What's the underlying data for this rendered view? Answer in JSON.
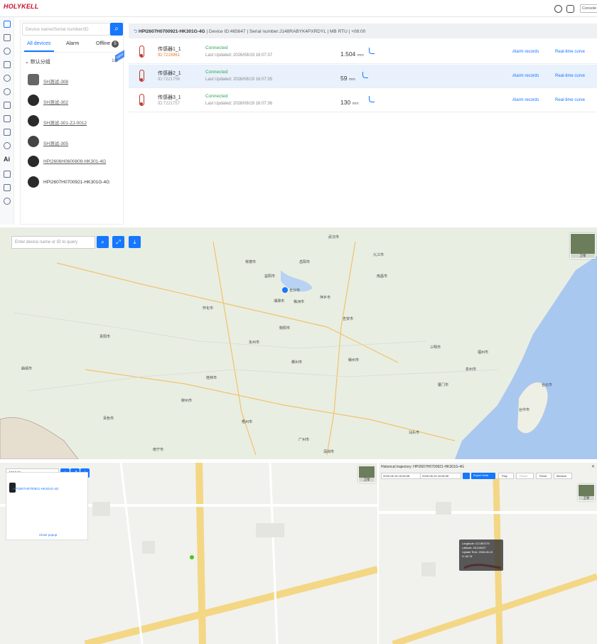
{
  "app": {
    "logo": "HOLYKELL",
    "logo_sub": "",
    "console_label": "Console"
  },
  "device_panel": {
    "search_placeholder": "Device name/Serial number/ID",
    "tabs": [
      {
        "label": "All devices"
      },
      {
        "label": "Alarm"
      },
      {
        "label": "Offline"
      }
    ],
    "offline_count": "5",
    "new_badge": "NEW",
    "group_label": "默认分组",
    "group_count": "1/6",
    "devices": [
      {
        "name": "SH测试-308"
      },
      {
        "name": "SH测试-302"
      },
      {
        "name": "SH测试-301-ZJ-0012"
      },
      {
        "name": "SH测试-305"
      },
      {
        "name": "HPI2606H0600809-HK301-4G"
      },
      {
        "name": "HPI2607H0700921-HK301G-4G"
      }
    ]
  },
  "sensor_header": {
    "device_name": "HPI2607H0700921-HK301G-4G",
    "device_id": "Device ID:465647",
    "serial": "Serial number:J148RABYK4PXRDYL",
    "protocol": "MB RTU",
    "timezone": "+08:00"
  },
  "sensors": [
    {
      "name": "传感器1_1",
      "id": "ID:7215961",
      "status": "Connected",
      "updated": "Last Updated: 2026/08/19 16:07:37",
      "value": "1.504",
      "unit": "mm",
      "alarm": "Alarm records",
      "realtime": "Real-time curve"
    },
    {
      "name": "传感器2_1",
      "id": "ID:7221756",
      "status": "Connected",
      "updated": "Last Updated: 2026/08/19 16:07:35",
      "value": "59",
      "unit": "mm",
      "alarm": "Alarm records",
      "realtime": "Real-time curve"
    },
    {
      "name": "传感器3_1",
      "id": "ID:7221757",
      "status": "Connected",
      "updated": "Last Updated: 2026/08/19 16:07:36",
      "value": "130",
      "unit": "mm",
      "alarm": "Alarm records",
      "realtime": "Real-time curve"
    }
  ],
  "map1": {
    "search_placeholder": "Enter device name or ID to query",
    "satellite_label": "卫星",
    "cities": [
      {
        "name": "长沙市"
      },
      {
        "name": "湘潭市"
      },
      {
        "name": "株洲市"
      },
      {
        "name": "益阳市"
      },
      {
        "name": "常德市"
      },
      {
        "name": "南昌市"
      },
      {
        "name": "九江市"
      },
      {
        "name": "贵阳市"
      },
      {
        "name": "福州市"
      },
      {
        "name": "广州市"
      },
      {
        "name": "南宁市"
      },
      {
        "name": "台北市"
      },
      {
        "name": "台中市"
      },
      {
        "name": "赣州市"
      },
      {
        "name": "郴州市"
      },
      {
        "name": "永州市"
      },
      {
        "name": "衡阳市"
      },
      {
        "name": "桂林市"
      },
      {
        "name": "梧州市"
      },
      {
        "name": "厦门市"
      },
      {
        "name": "泉州市"
      },
      {
        "name": "三明市"
      },
      {
        "name": "吉安市"
      },
      {
        "name": "萍乡市"
      },
      {
        "name": "怀化市"
      },
      {
        "name": "岳阳市"
      },
      {
        "name": "武汉市"
      },
      {
        "name": "深圳市"
      },
      {
        "name": "汕头市"
      },
      {
        "name": "百色市"
      },
      {
        "name": "柳州市"
      },
      {
        "name": "曲靖市"
      }
    ]
  },
  "map2": {
    "search_value": "465647",
    "popup_device": "HPI2607H0700921-HK301G-4G",
    "close_label": "Close popup",
    "satellite_label": "卫星"
  },
  "map3": {
    "title": "Historical trajectory: HPI2607H0700921-HK301G-4G",
    "date_from": "2026-08-18 16:08:08",
    "date_to": "2026-08-19 16:08:08",
    "export_label": "Export Data",
    "play_label": "Play",
    "pause_label": "Pause",
    "reset_label": "Reset",
    "speed_label": "Medium",
    "tooltip": {
      "lon": "Longitude: 112.887279",
      "lat": "Latitude: 28.216637",
      "time": "Update Time: 2026-08-19",
      "h": "H: 84.76"
    },
    "satellite_label": "卫星"
  }
}
